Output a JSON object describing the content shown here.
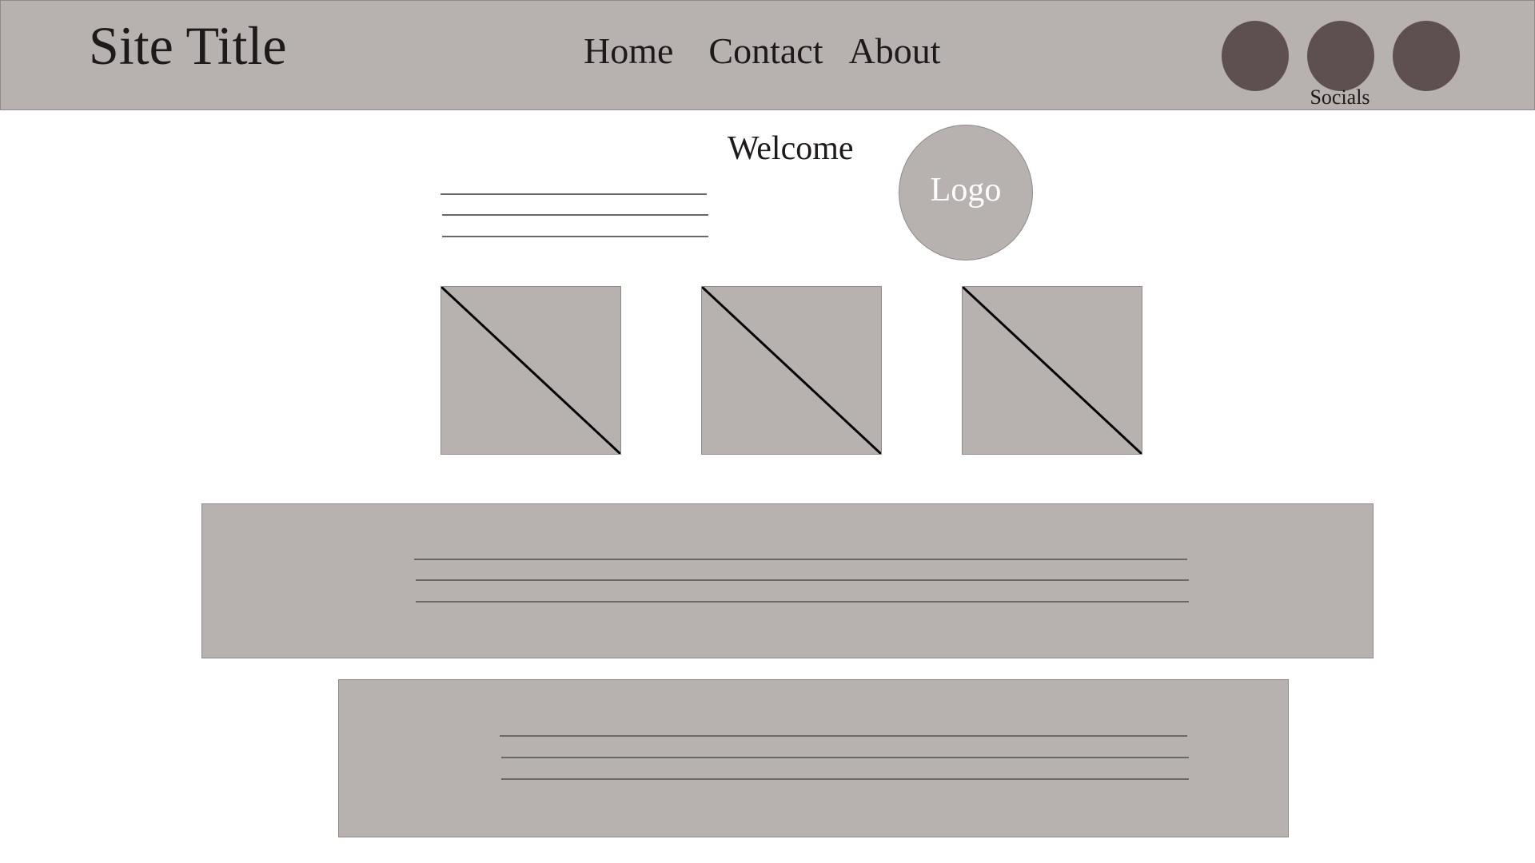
{
  "header": {
    "site_title": "Site Title",
    "nav": [
      {
        "label": "Home"
      },
      {
        "label": "Contact"
      },
      {
        "label": "About"
      }
    ],
    "socials_label": "Socials",
    "socials": [
      {
        "icon": "social-circle-icon"
      },
      {
        "icon": "social-circle-icon"
      },
      {
        "icon": "social-circle-icon"
      }
    ]
  },
  "intro": {
    "welcome": "Welcome",
    "logo": "Logo"
  },
  "colors": {
    "placeholder_gray": "#b7b1b0",
    "social_dark": "#5e5050",
    "text_dark": "#1e1a1a",
    "line_gray": "#6a6766"
  }
}
